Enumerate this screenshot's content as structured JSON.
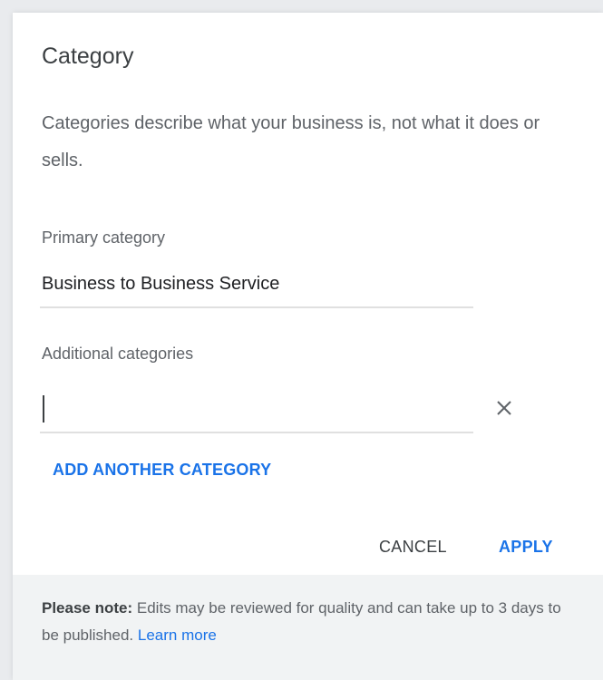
{
  "dialog": {
    "title": "Category",
    "description": "Categories describe what your business is, not what it does or sells."
  },
  "primary": {
    "label": "Primary category",
    "value": "Business to Business Service"
  },
  "additional": {
    "label": "Additional categories",
    "input_value": "",
    "clear_icon": "close-icon"
  },
  "actions": {
    "add_another": "ADD ANOTHER CATEGORY",
    "cancel": "CANCEL",
    "apply": "APPLY"
  },
  "note": {
    "prefix": "Please note:",
    "text": " Edits may be reviewed for quality and can take up to 3 days to be published. ",
    "link": "Learn more"
  },
  "colors": {
    "accent": "#1a73e8",
    "note_background": "#f1f3f4"
  }
}
